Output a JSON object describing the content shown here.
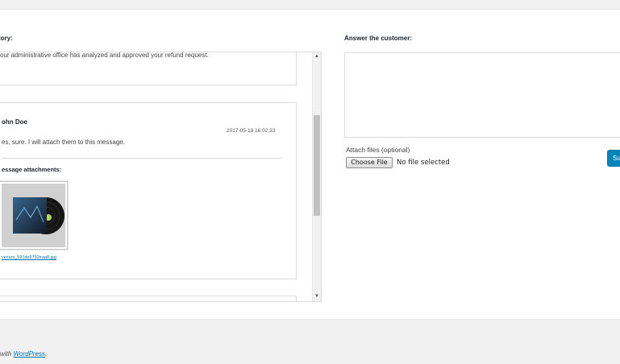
{
  "history": {
    "label": "tory:",
    "messages": [
      {
        "text": "our administrative office has analyzed and approved your refund request."
      },
      {
        "author": "ohn Doe",
        "date": "2017-05-18 16:02:33",
        "text": "es, sure. I will attach them to this message.",
        "attachments_title": "essage attachments:",
        "attachment_file": "vecars_591de9792eaa8.jpg"
      }
    ]
  },
  "answer": {
    "label": "Answer the customer:",
    "attach_label": "Attach files (optional)",
    "choose_file_label": "Choose File",
    "no_file_text": "No file selected",
    "submit_label": "Su"
  },
  "footer": {
    "prefix": "with ",
    "link": "WordPress",
    "suffix": "."
  },
  "colors": {
    "accent": "#0085ba",
    "link": "#0073aa",
    "background": "#f1f1f1"
  }
}
